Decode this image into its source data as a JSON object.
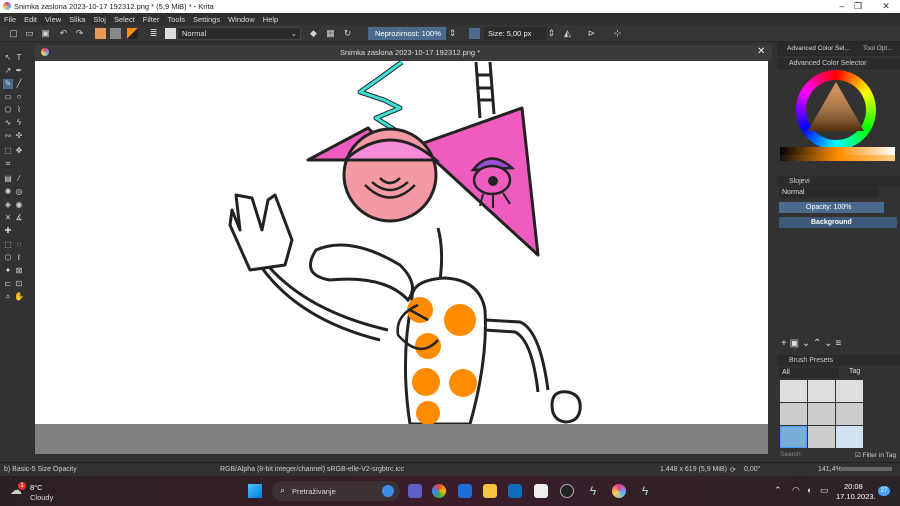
{
  "window": {
    "title": "Snimka zaslona 2023-10-17 192312.png * (5,9 MiB) * - Krita"
  },
  "menu": [
    "File",
    "Edit",
    "View",
    "Slika",
    "Sloj",
    "Select",
    "Filter",
    "Tools",
    "Settings",
    "Window",
    "Help"
  ],
  "toolbar": {
    "blend_mode": "Normal",
    "opacity_label": "Neprozirnost: 100%",
    "size_label": "Size: 5,00 px"
  },
  "document": {
    "tab_title": "Snimka zaslona 2023-10-17 192312.png *"
  },
  "right_dock": {
    "tabs": [
      "Advanced Color Sel...",
      "Tool Opt..."
    ],
    "color_selector_title": "Advanced Color Selector",
    "layers_title": "Slojevi",
    "layers_blend": "Normal",
    "layers_opacity": "Opacity:  100%",
    "layer_name": "Background",
    "brush_presets_title": "Brush Presets",
    "brush_filter": "All",
    "brush_tag": "Tag",
    "search_placeholder": "Search",
    "filter_in_tag": "Filter in Tag"
  },
  "status": {
    "brush": "b) Basic-5 Size Opacity",
    "color_profile": "RGB/Alpha (8-bit integer/channel)  sRGB-elle-V2-srgbtrc.icc",
    "dimensions": "1.448 x 619 (5,9 MiB)",
    "rotation": "0,00°",
    "zoom": "141,4%"
  },
  "taskbar": {
    "weather_temp": "8°C",
    "weather_desc": "Cloudy",
    "search_placeholder": "Pretraživanje",
    "time": "20:08",
    "date": "17.10.2023.",
    "notification_count": "27",
    "weather_badge": "1"
  },
  "colors": {
    "pink": "#ee5cc0",
    "light_pink": "#f49aa5",
    "orange": "#ff8c00",
    "cyan": "#3ee0d8",
    "purple": "#9b4fd1",
    "accent_blue": "#4a6a8e"
  }
}
